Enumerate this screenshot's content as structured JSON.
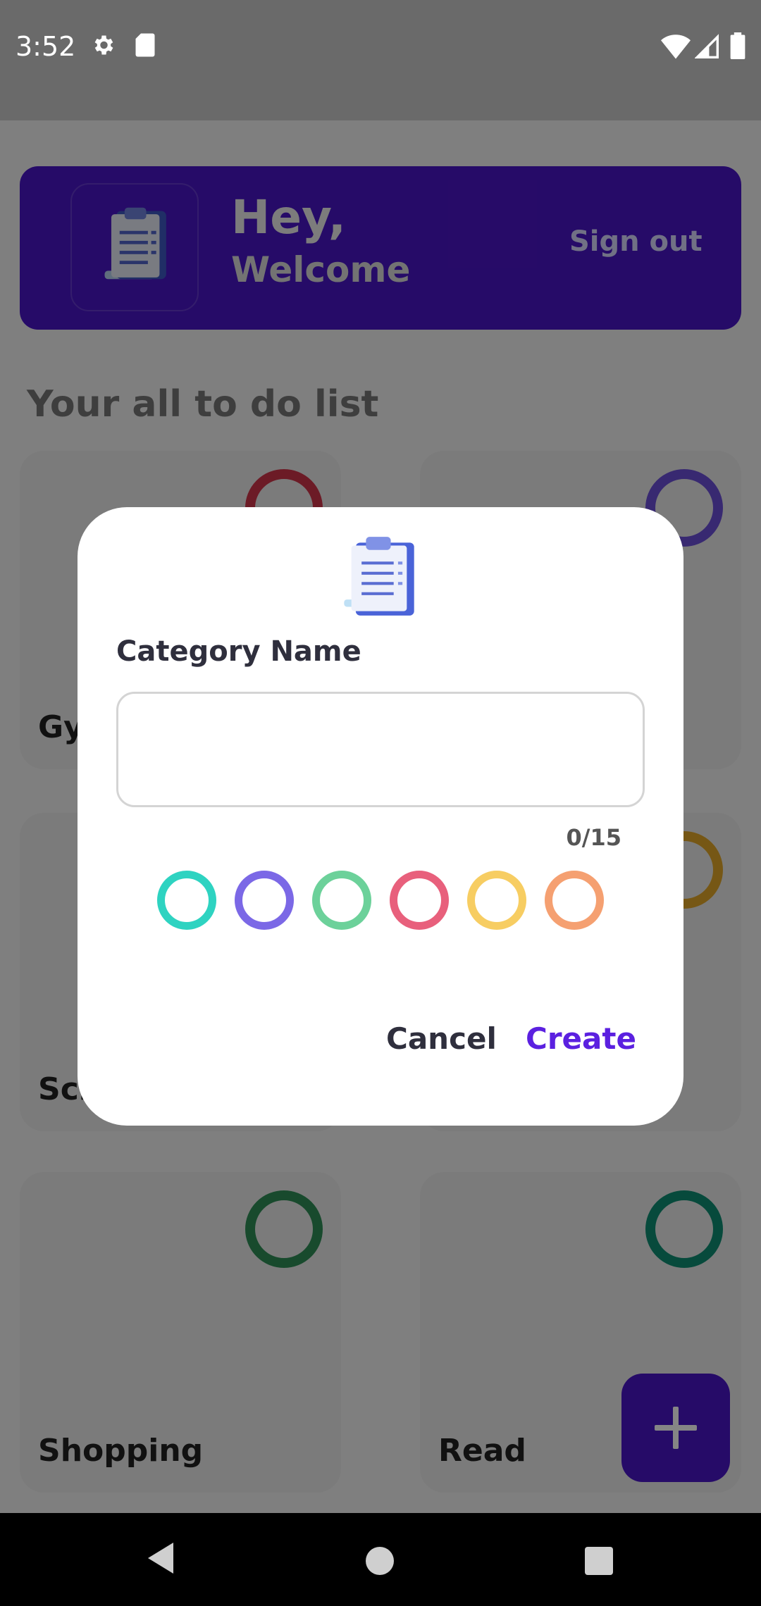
{
  "status_bar": {
    "time": "3:52",
    "left_icons": [
      "settings-icon",
      "sd-card-icon"
    ],
    "right_icons": [
      "wifi-icon",
      "signal-icon",
      "battery-icon"
    ]
  },
  "header": {
    "greeting": "Hey,",
    "welcome": "Welcome",
    "sign_out": "Sign out",
    "logo_icon": "clipboard-icon"
  },
  "section_title": "Your all to do list",
  "categories": [
    {
      "label": "Gym",
      "ring_color": "#d0344a"
    },
    {
      "label": "",
      "ring_color": "#6b4fd8"
    },
    {
      "label": "School",
      "ring_color": "#d7c7c7"
    },
    {
      "label": "",
      "ring_color": "#e2a82a"
    },
    {
      "label": "Shopping",
      "ring_color": "#2e8f57"
    },
    {
      "label": "Read",
      "ring_color": "#0f8e73"
    }
  ],
  "fab": {
    "icon": "plus-icon"
  },
  "dialog": {
    "icon": "clipboard-icon",
    "title": "Category Name",
    "input_value": "",
    "input_placeholder": "",
    "counter": "0/15",
    "colors": [
      "#2ed3c1",
      "#7b68e6",
      "#6cd19a",
      "#e8607c",
      "#f7cd62",
      "#f5a071"
    ],
    "cancel": "Cancel",
    "create": "Create"
  },
  "nav_bar": {
    "icons": [
      "back-icon",
      "home-icon",
      "recents-icon"
    ]
  }
}
